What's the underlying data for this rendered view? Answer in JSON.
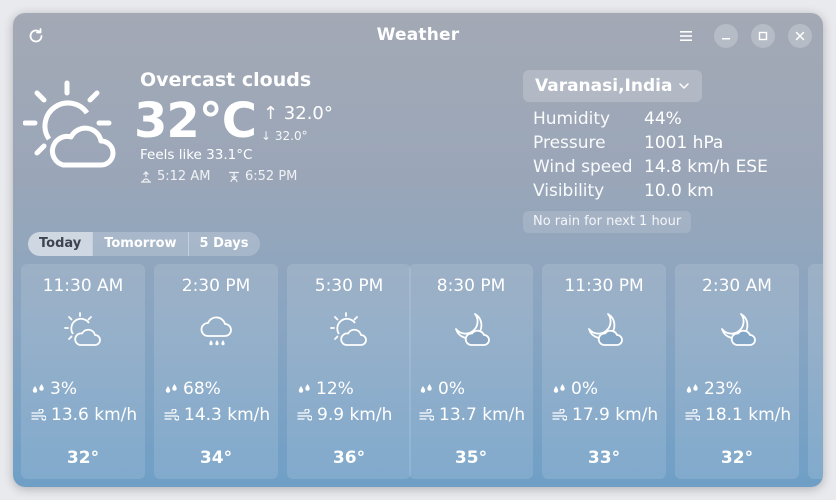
{
  "window": {
    "title": "Weather"
  },
  "current": {
    "condition": "Overcast clouds",
    "temperature": "32°C",
    "high": "↑ 32.0°",
    "low": "↓ 32.0°",
    "feels_like": "Feels like 33.1°C",
    "sunrise": "5:12 AM",
    "sunset": "6:52 PM",
    "icon": "sun-cloud-icon"
  },
  "location": {
    "name": "Varanasi,India"
  },
  "details": [
    {
      "label": "Humidity",
      "value": "44%"
    },
    {
      "label": "Pressure",
      "value": "1001 hPa"
    },
    {
      "label": "Wind speed",
      "value": "14.8 km/h ESE"
    },
    {
      "label": "Visibility",
      "value": "10.0 km"
    }
  ],
  "rain_note": "No rain for next 1 hour",
  "tabs": [
    {
      "label": "Today",
      "active": true
    },
    {
      "label": "Tomorrow",
      "active": false
    },
    {
      "label": "5 Days",
      "active": false
    }
  ],
  "forecast": [
    {
      "time": "11:30 AM",
      "icon": "sun-cloud-icon",
      "precip": "3%",
      "wind": "13.6 km/h",
      "temp": "32°"
    },
    {
      "time": "2:30 PM",
      "icon": "rain-cloud-icon",
      "precip": "68%",
      "wind": "14.3 km/h",
      "temp": "34°"
    },
    {
      "time": "5:30 PM",
      "icon": "sun-cloud-icon",
      "precip": "12%",
      "wind": "9.9 km/h",
      "temp": "36°"
    },
    {
      "time": "8:30 PM",
      "icon": "moon-cloud-icon",
      "precip": "0%",
      "wind": "13.7 km/h",
      "temp": "35°"
    },
    {
      "time": "11:30 PM",
      "icon": "moon-cloud-icon",
      "precip": "0%",
      "wind": "17.9 km/h",
      "temp": "33°"
    },
    {
      "time": "2:30 AM",
      "icon": "moon-cloud-icon",
      "precip": "23%",
      "wind": "18.1 km/h",
      "temp": "32°"
    }
  ]
}
